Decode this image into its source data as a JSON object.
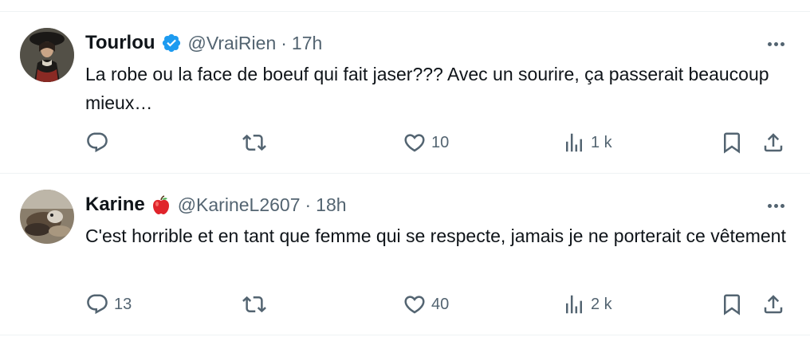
{
  "posts": [
    {
      "author": "Tourlou",
      "verified": true,
      "handle": "@VraiRien",
      "separator": "·",
      "time": "17h",
      "text": "La robe ou la face de boeuf qui fait jaser??? Avec un sourire, ça passerait beaucoup mieux…",
      "replies": "",
      "reposts": "",
      "likes": "10",
      "views": "1 k"
    },
    {
      "author": "Karine",
      "emoji": "🍎",
      "handle": "@KarineL2607",
      "separator": "·",
      "time": "18h",
      "text": "C'est horrible et en tant que femme qui se respecte, jamais je ne porterait ce vêtement",
      "replies": "13",
      "reposts": "",
      "likes": "40",
      "views": "2 k"
    }
  ],
  "colors": {
    "text": "#0f1419",
    "secondary": "#536471",
    "verified": "#1d9bf0",
    "divider": "#eff3f4",
    "apple": "#e0242b"
  },
  "icons": [
    "reply-icon",
    "repost-icon",
    "like-icon",
    "views-icon",
    "bookmark-icon",
    "share-icon",
    "more-icon",
    "verified-badge-icon",
    "apple-emoji-icon"
  ]
}
